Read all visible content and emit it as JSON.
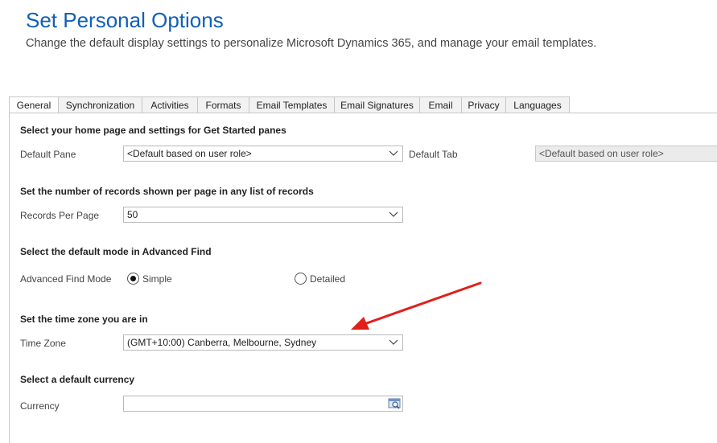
{
  "page": {
    "title": "Set Personal Options",
    "subtitle": "Change the default display settings to personalize Microsoft Dynamics 365, and manage your email templates."
  },
  "tabs": [
    {
      "label": "General",
      "active": true
    },
    {
      "label": "Synchronization"
    },
    {
      "label": "Activities"
    },
    {
      "label": "Formats"
    },
    {
      "label": "Email Templates"
    },
    {
      "label": "Email Signatures"
    },
    {
      "label": "Email"
    },
    {
      "label": "Privacy"
    },
    {
      "label": "Languages"
    }
  ],
  "sections": {
    "home": {
      "heading": "Select your home page and settings for Get Started panes",
      "pane_label": "Default Pane",
      "pane_value": "<Default based on user role>",
      "tab_label": "Default Tab",
      "tab_value": "<Default based on user role>"
    },
    "records": {
      "heading": "Set the number of records shown per page in any list of records",
      "label": "Records Per Page",
      "value": "50"
    },
    "advanced_find": {
      "heading": "Select the default mode in Advanced Find",
      "label": "Advanced Find Mode",
      "option_simple": "Simple",
      "option_detailed": "Detailed",
      "selected": "Simple"
    },
    "timezone": {
      "heading": "Set the time zone you are in",
      "label": "Time Zone",
      "value": "(GMT+10:00) Canberra, Melbourne, Sydney"
    },
    "currency": {
      "heading": "Select a default currency",
      "label": "Currency",
      "value": ""
    }
  },
  "icons": {
    "dropdown": "chevron-down-icon",
    "lookup": "lookup-icon"
  },
  "colors": {
    "title": "#1160b7",
    "annotation_arrow": "#e0201b"
  }
}
